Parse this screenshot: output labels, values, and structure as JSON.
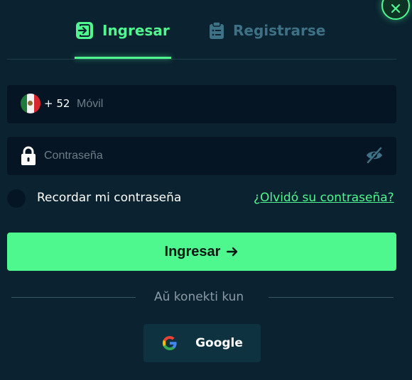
{
  "tabs": {
    "login_label": "Ingresar",
    "register_label": "Registrarse"
  },
  "phone": {
    "country_code": "+ 52",
    "placeholder": "Móvil"
  },
  "password": {
    "placeholder": "Contraseña"
  },
  "remember_label": "Recordar mi contraseña",
  "forgot_label": "¿Olvidó su contraseña?",
  "submit_label": "Ingresar",
  "divider_text": "Aŭ konekti kun",
  "google_label": "Google",
  "colors": {
    "background": "#0b2230",
    "accent": "#4ef88f",
    "field": "#051524",
    "inactive_tab": "#3d7286"
  },
  "icons": [
    "close-icon",
    "login-icon",
    "clipboard-icon",
    "mexico-flag-icon",
    "lock-icon",
    "eye-off-icon",
    "arrow-right-icon",
    "google-icon"
  ]
}
